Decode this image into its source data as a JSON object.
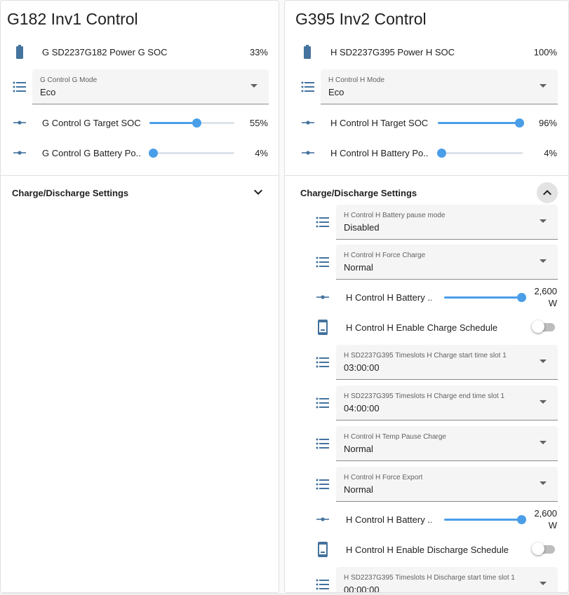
{
  "colors": {
    "accent": "#4a9ee8",
    "icon": "#44739e",
    "toggle_off": "#bdbdbd"
  },
  "card_g": {
    "title": "G182 Inv1 Control",
    "soc": {
      "icon": "battery-icon",
      "label": "G SD2237G182 Power G SOC",
      "value": "33%"
    },
    "mode": {
      "icon": "list-icon",
      "caption": "G Control G Mode",
      "value": "Eco"
    },
    "target_soc": {
      "icon": "slider-icon",
      "label": "G Control G Target SOC",
      "value": "55%",
      "level": 0.55
    },
    "battery_power": {
      "icon": "slider-icon",
      "label": "G Control G Battery Po...",
      "value": "4%",
      "level": 0.04
    },
    "section": {
      "title": "Charge/Discharge Settings",
      "expanded": false
    }
  },
  "card_h": {
    "title": "G395 Inv2 Control",
    "soc": {
      "icon": "battery-icon",
      "label": "H SD2237G395 Power H SOC",
      "value": "100%"
    },
    "mode": {
      "icon": "list-icon",
      "caption": "H Control H Mode",
      "value": "Eco"
    },
    "target_soc": {
      "icon": "slider-icon",
      "label": "H Control H Target SOC",
      "value": "96%",
      "level": 0.96
    },
    "battery_power": {
      "icon": "slider-icon",
      "label": "H Control H Battery Po...",
      "value": "4%",
      "level": 0.04
    },
    "section": {
      "title": "Charge/Discharge Settings",
      "expanded": true,
      "pause_mode": {
        "caption": "H Control H Battery pause mode",
        "value": "Disabled"
      },
      "force_charge": {
        "caption": "H Control H Force Charge",
        "value": "Normal"
      },
      "charge_rate": {
        "label": "H Control H Battery ...",
        "value_num": "2,600",
        "value_unit": "W",
        "level": 1.0
      },
      "enable_charge": {
        "label": "H Control H Enable Charge Schedule",
        "on": false
      },
      "charge_start": {
        "caption": "H SD2237G395 Timeslots H Charge start time slot 1",
        "value": "03:00:00"
      },
      "charge_end": {
        "caption": "H SD2237G395 Timeslots H Charge end time slot 1",
        "value": "04:00:00"
      },
      "temp_pause": {
        "caption": "H Control H Temp Pause Charge",
        "value": "Normal"
      },
      "force_export": {
        "caption": "H Control H Force Export",
        "value": "Normal"
      },
      "discharge_rate": {
        "label": "H Control H Battery ...",
        "value_num": "2,600",
        "value_unit": "W",
        "level": 1.0
      },
      "enable_discharge": {
        "label": "H Control H Enable Discharge Schedule",
        "on": false
      },
      "discharge_start": {
        "caption": "H SD2237G395 Timeslots H Discharge start time slot 1",
        "value": "00:00:00"
      }
    }
  }
}
